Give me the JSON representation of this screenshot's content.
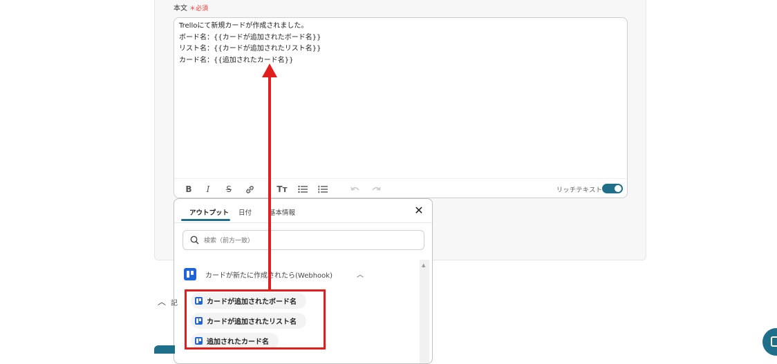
{
  "field": {
    "label": "本文",
    "required": "＊必須"
  },
  "editor": {
    "content": "Trelloにて新規カードが作成されました。\nボード名：{{カードが追加されたボード名}}\nリスト名：{{カードが追加されたリスト名}}\nカード名：{{追加されたカード名}}",
    "toolbar": {
      "bold": "B",
      "italic": "I",
      "strike": "S",
      "link": "link",
      "heading": "Tт",
      "bullet": "bullet-list",
      "ordered": "ordered-list",
      "undo": "undo",
      "redo": "redo"
    },
    "rich_text_label": "リッチテキスト",
    "rich_text_on": true
  },
  "popup": {
    "tabs": [
      "アウトプット",
      "日付",
      "基本情報"
    ],
    "active_tab": "アウトプット",
    "search_placeholder": "検索（前方一致）",
    "section_title": "カードが新たに作成されたら(Webhook)",
    "items": [
      {
        "label": "カードが追加されたボード名"
      },
      {
        "label": "カードが追加されたリスト名"
      },
      {
        "label": "追加されたカード名"
      }
    ]
  },
  "side_fragment": "記",
  "colors": {
    "accent": "#1f6f8b",
    "annotation": "#e01e1e",
    "trello": "#1f63d8"
  }
}
